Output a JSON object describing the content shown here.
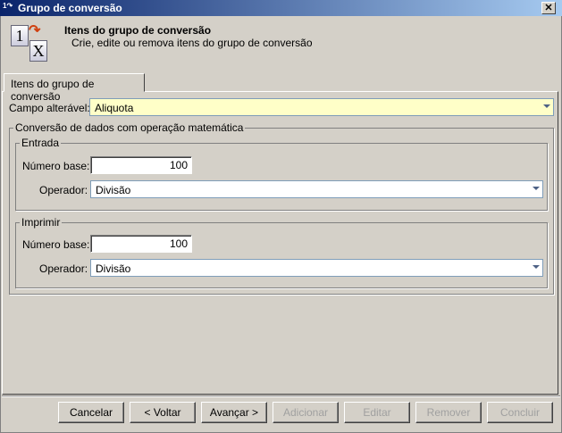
{
  "window": {
    "title": "Grupo de conversão",
    "close_label": "✕"
  },
  "header": {
    "title": "Itens do grupo de conversão",
    "subtitle": "Crie, edite ou remova itens do grupo de conversão",
    "icon_from": "1",
    "icon_to": "X"
  },
  "tab": {
    "label": "Itens do grupo de conversão"
  },
  "campo": {
    "label": "Campo alterável:",
    "value": "Aliquota",
    "bg_color": "#ffffc8"
  },
  "conversao": {
    "legend": "Conversão de dados com operação matemática",
    "entrada": {
      "legend": "Entrada",
      "base_label": "Número base:",
      "base_value": "100",
      "op_label": "Operador:",
      "op_value": "Divisão"
    },
    "imprimir": {
      "legend": "Imprimir",
      "base_label": "Número base:",
      "base_value": "100",
      "op_label": "Operador:",
      "op_value": "Divisão"
    }
  },
  "buttons": {
    "cancel": "Cancelar",
    "back": "< Voltar",
    "next": "Avançar >",
    "add": "Adicionar",
    "edit": "Editar",
    "remove": "Remover",
    "finish": "Concluir"
  }
}
